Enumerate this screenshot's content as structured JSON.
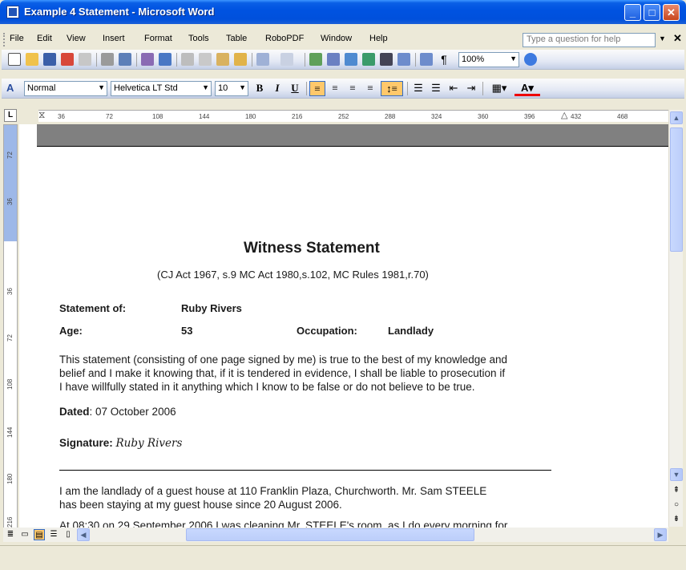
{
  "window": {
    "title": "Example 4 Statement - Microsoft Word"
  },
  "menu": {
    "items": [
      "File",
      "Edit",
      "View",
      "Insert",
      "Format",
      "Tools",
      "Table",
      "RoboPDF",
      "Window",
      "Help"
    ],
    "help_placeholder": "Type a question for help"
  },
  "standard_toolbar": {
    "zoom": "100%",
    "paragraph_mark": "¶"
  },
  "formatting_toolbar": {
    "style": "Normal",
    "font": "Helvetica LT Std",
    "size": "10",
    "bold": "B",
    "italic": "I",
    "underline": "U",
    "font_color_letter": "A"
  },
  "ruler": {
    "horizontal_ticks": [
      "36",
      "72",
      "108",
      "144",
      "180",
      "216",
      "252",
      "288",
      "324",
      "360",
      "396",
      "432",
      "468"
    ],
    "vertical_ticks": [
      "72",
      "36",
      "36",
      "72",
      "108",
      "144",
      "180",
      "216"
    ]
  },
  "document": {
    "heading": "Witness Statement",
    "subheading": "(CJ Act 1967, s.9 MC Act 1980,s.102, MC Rules 1981,r.70)",
    "statement_of_label": "Statement of:",
    "statement_of_value": "Ruby Rivers",
    "age_label": "Age:",
    "age_value": "53",
    "occupation_label": "Occupation:",
    "occupation_value": "Landlady",
    "declaration_lines": [
      "This statement (consisting of one page signed by me) is true to the best of my knowledge and",
      "belief and I make it knowing that, if it is tendered in evidence, I shall be liable to prosecution if",
      "I have willfully stated in it anything which I know to be false or do not believe to be true."
    ],
    "dated_label": "Dated",
    "dated_value": ": 07 October 2006",
    "signature_label": "Signature",
    "signature_value": "Ruby Rivers",
    "body_lines": [
      "I am the landlady of a guest house at 110 Franklin Plaza, Churchworth.  Mr. Sam STEELE",
      "has been staying at my guest house since 20 August 2006.",
      "At 08:30 on 29 September 2006 I was cleaning Mr. STEELE's room, as I do every morning for"
    ]
  }
}
